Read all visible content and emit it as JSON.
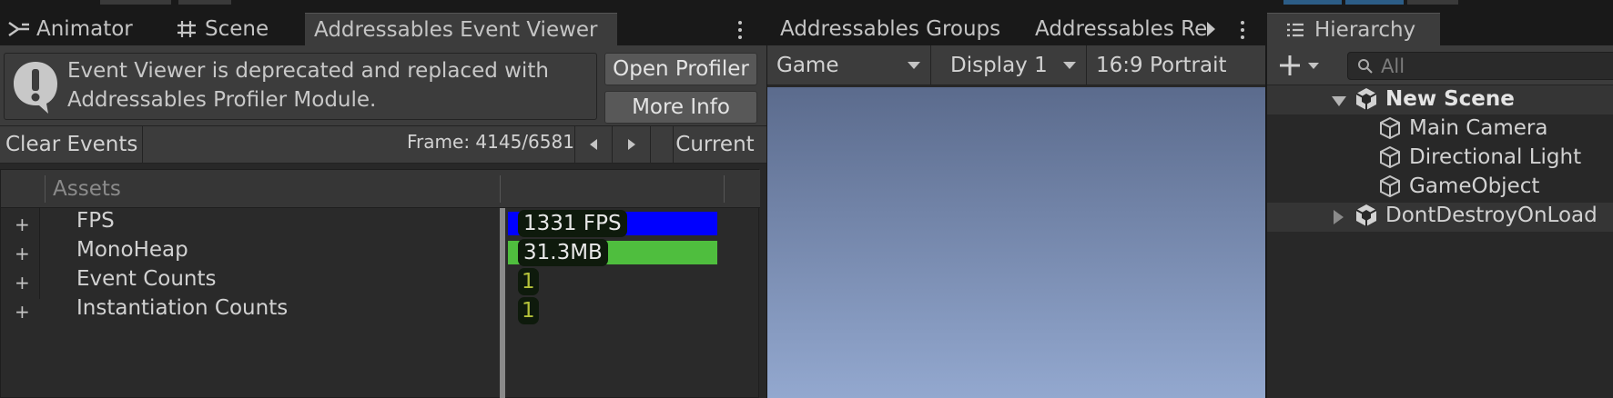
{
  "left_panel": {
    "tabs": [
      {
        "label": "Animator",
        "icon": "animator-icon"
      },
      {
        "label": "Scene",
        "icon": "grid-hash-icon"
      },
      {
        "label": "Addressables Event Viewer",
        "active": true
      }
    ],
    "warning": {
      "icon": "exclamation-bubble-icon",
      "line1": "Event Viewer is deprecated and replaced with",
      "line2": "Addressables Profiler Module."
    },
    "buttons": {
      "open_profiler": "Open Profiler",
      "more_info": "More Info"
    },
    "toolbar": {
      "clear_events": "Clear Events",
      "frame": "Frame: 4145/6581",
      "current": "Current"
    },
    "table": {
      "column_header": "Assets",
      "rows": [
        {
          "label": "FPS",
          "value": "1331 FPS",
          "bar_color": "#0000ff",
          "bar_fill": 1.0
        },
        {
          "label": "MonoHeap",
          "value": "31.3MB",
          "bar_color": "#4fbe3e",
          "bar_fill": 1.0
        },
        {
          "label": "Event Counts",
          "value": "1"
        },
        {
          "label": "Instantiation Counts",
          "value": "1"
        }
      ]
    }
  },
  "middle_panel": {
    "tabs": [
      {
        "label": "Addressables Groups"
      },
      {
        "label": "Addressables Re"
      }
    ],
    "game_toolbar": {
      "view": "Game",
      "display": "Display 1",
      "aspect": "16:9 Portrait"
    },
    "sky_colors": {
      "top": "#5b6b8d",
      "bottom": "#93a8cf"
    }
  },
  "right_panel": {
    "tab": {
      "label": "Hierarchy",
      "icon": "list-icon"
    },
    "search_placeholder": "All",
    "items": [
      {
        "label": "New Scene",
        "bold": true,
        "expanded": true
      },
      {
        "label": "Main Camera"
      },
      {
        "label": "Directional Light"
      },
      {
        "label": "GameObject"
      },
      {
        "label": "DontDestroyOnLoad",
        "expanded": false
      }
    ]
  },
  "colors": {
    "fps_bar": "#0000ff",
    "monoheap_bar": "#4fbe3e",
    "count_text": "#b5c23a"
  }
}
